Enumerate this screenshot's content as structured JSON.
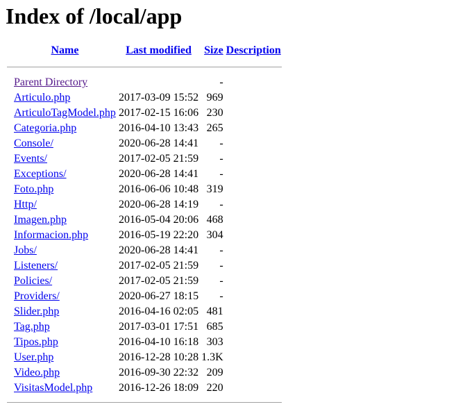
{
  "page": {
    "title": "Index of /local/app"
  },
  "columns": {
    "name": "Name",
    "last_modified": "Last modified",
    "size": "Size",
    "description": "Description"
  },
  "entries": [
    {
      "name": "Parent Directory",
      "date": "",
      "size": "-",
      "visited": true
    },
    {
      "name": "Articulo.php",
      "date": "2017-03-09 15:52",
      "size": "969"
    },
    {
      "name": "ArticuloTagModel.php",
      "date": "2017-02-15 16:06",
      "size": "230"
    },
    {
      "name": "Categoria.php",
      "date": "2016-04-10 13:43",
      "size": "265"
    },
    {
      "name": "Console/",
      "date": "2020-06-28 14:41",
      "size": "-"
    },
    {
      "name": "Events/",
      "date": "2017-02-05 21:59",
      "size": "-"
    },
    {
      "name": "Exceptions/",
      "date": "2020-06-28 14:41",
      "size": "-"
    },
    {
      "name": "Foto.php",
      "date": "2016-06-06 10:48",
      "size": "319"
    },
    {
      "name": "Http/",
      "date": "2020-06-28 14:19",
      "size": "-"
    },
    {
      "name": "Imagen.php",
      "date": "2016-05-04 20:06",
      "size": "468"
    },
    {
      "name": "Informacion.php",
      "date": "2016-05-19 22:20",
      "size": "304"
    },
    {
      "name": "Jobs/",
      "date": "2020-06-28 14:41",
      "size": "-"
    },
    {
      "name": "Listeners/",
      "date": "2017-02-05 21:59",
      "size": "-"
    },
    {
      "name": "Policies/",
      "date": "2017-02-05 21:59",
      "size": "-"
    },
    {
      "name": "Providers/",
      "date": "2020-06-27 18:15",
      "size": "-"
    },
    {
      "name": "Slider.php",
      "date": "2016-04-16 02:05",
      "size": "481"
    },
    {
      "name": "Tag.php",
      "date": "2017-03-01 17:51",
      "size": "685"
    },
    {
      "name": "Tipos.php",
      "date": "2016-04-10 16:18",
      "size": "303"
    },
    {
      "name": "User.php",
      "date": "2016-12-28 10:28",
      "size": "1.3K"
    },
    {
      "name": "Video.php",
      "date": "2016-09-30 22:32",
      "size": "209"
    },
    {
      "name": "VisitasModel.php",
      "date": "2016-12-26 18:09",
      "size": "220"
    }
  ],
  "colors": {
    "link": "#0000ee",
    "visited_link": "#551a8b",
    "rule": "#a0a0a0"
  }
}
